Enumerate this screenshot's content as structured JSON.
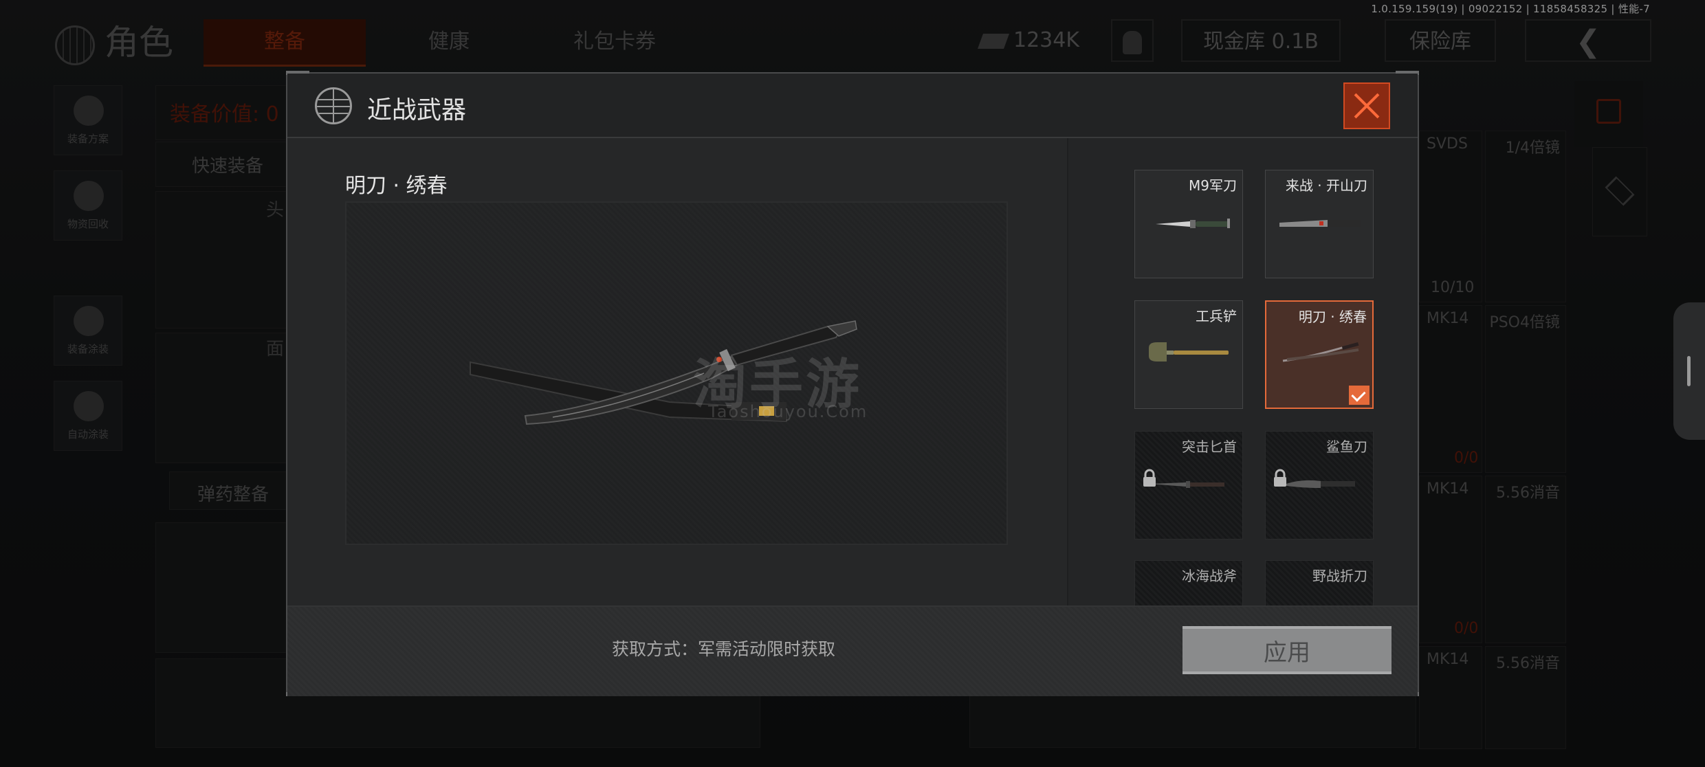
{
  "version_info": "1.0.159.159(19) | 09022152 | 11858458325 | 性能-7",
  "background": {
    "title": "角色",
    "tabs": [
      "整备",
      "健康",
      "礼包卡券"
    ],
    "currency": "1234K",
    "cash_vault": "现金库 0.1B",
    "insurance": "保险库",
    "side_buttons": [
      "装备方案",
      "物资回收",
      "装备涂装",
      "自动涂装"
    ],
    "equipment_value": "装备价值: 0",
    "quick_equip": "快速装备",
    "slot_head": "头",
    "slot_face": "面",
    "ammo_equip": "弹药整备",
    "right_cells": [
      {
        "name": "SVDS",
        "scope": "1/4倍镜",
        "count": "10/10"
      },
      {
        "name": "MK14",
        "scope": "PSO4倍镜",
        "count": "0/0"
      },
      {
        "name": "MK14",
        "scope": "5.56消音",
        "count": "0/0"
      },
      {
        "name": "MK14",
        "scope": "5.56消音",
        "count": ""
      }
    ]
  },
  "modal": {
    "title": "近战武器",
    "selected_weapon": "明刀 · 绣春",
    "watermark": "淘手游",
    "watermark_sub": "Taoshouyou.Com",
    "acquire_text": "获取方式：军需活动限时获取",
    "apply_label": "应用",
    "weapons": [
      {
        "name": "M9军刀",
        "state": "unlocked",
        "icon": "bayonet-icon"
      },
      {
        "name": "来战 · 开山刀",
        "state": "unlocked",
        "icon": "machete-icon"
      },
      {
        "name": "工兵铲",
        "state": "unlocked",
        "icon": "shovel-icon"
      },
      {
        "name": "明刀 · 绣春",
        "state": "selected",
        "icon": "sword-icon"
      },
      {
        "name": "突击匕首",
        "state": "locked",
        "icon": "dagger-icon"
      },
      {
        "name": "鲨鱼刀",
        "state": "locked",
        "icon": "knife-icon"
      },
      {
        "name": "冰海战斧",
        "state": "locked",
        "icon": "axe-icon"
      },
      {
        "name": "野战折刀",
        "state": "locked",
        "icon": "folding-knife-icon"
      }
    ]
  },
  "colors": {
    "accent": "#e56a3a",
    "close_bg": "#8a2a12",
    "apply_bg": "#8a8b8c"
  }
}
